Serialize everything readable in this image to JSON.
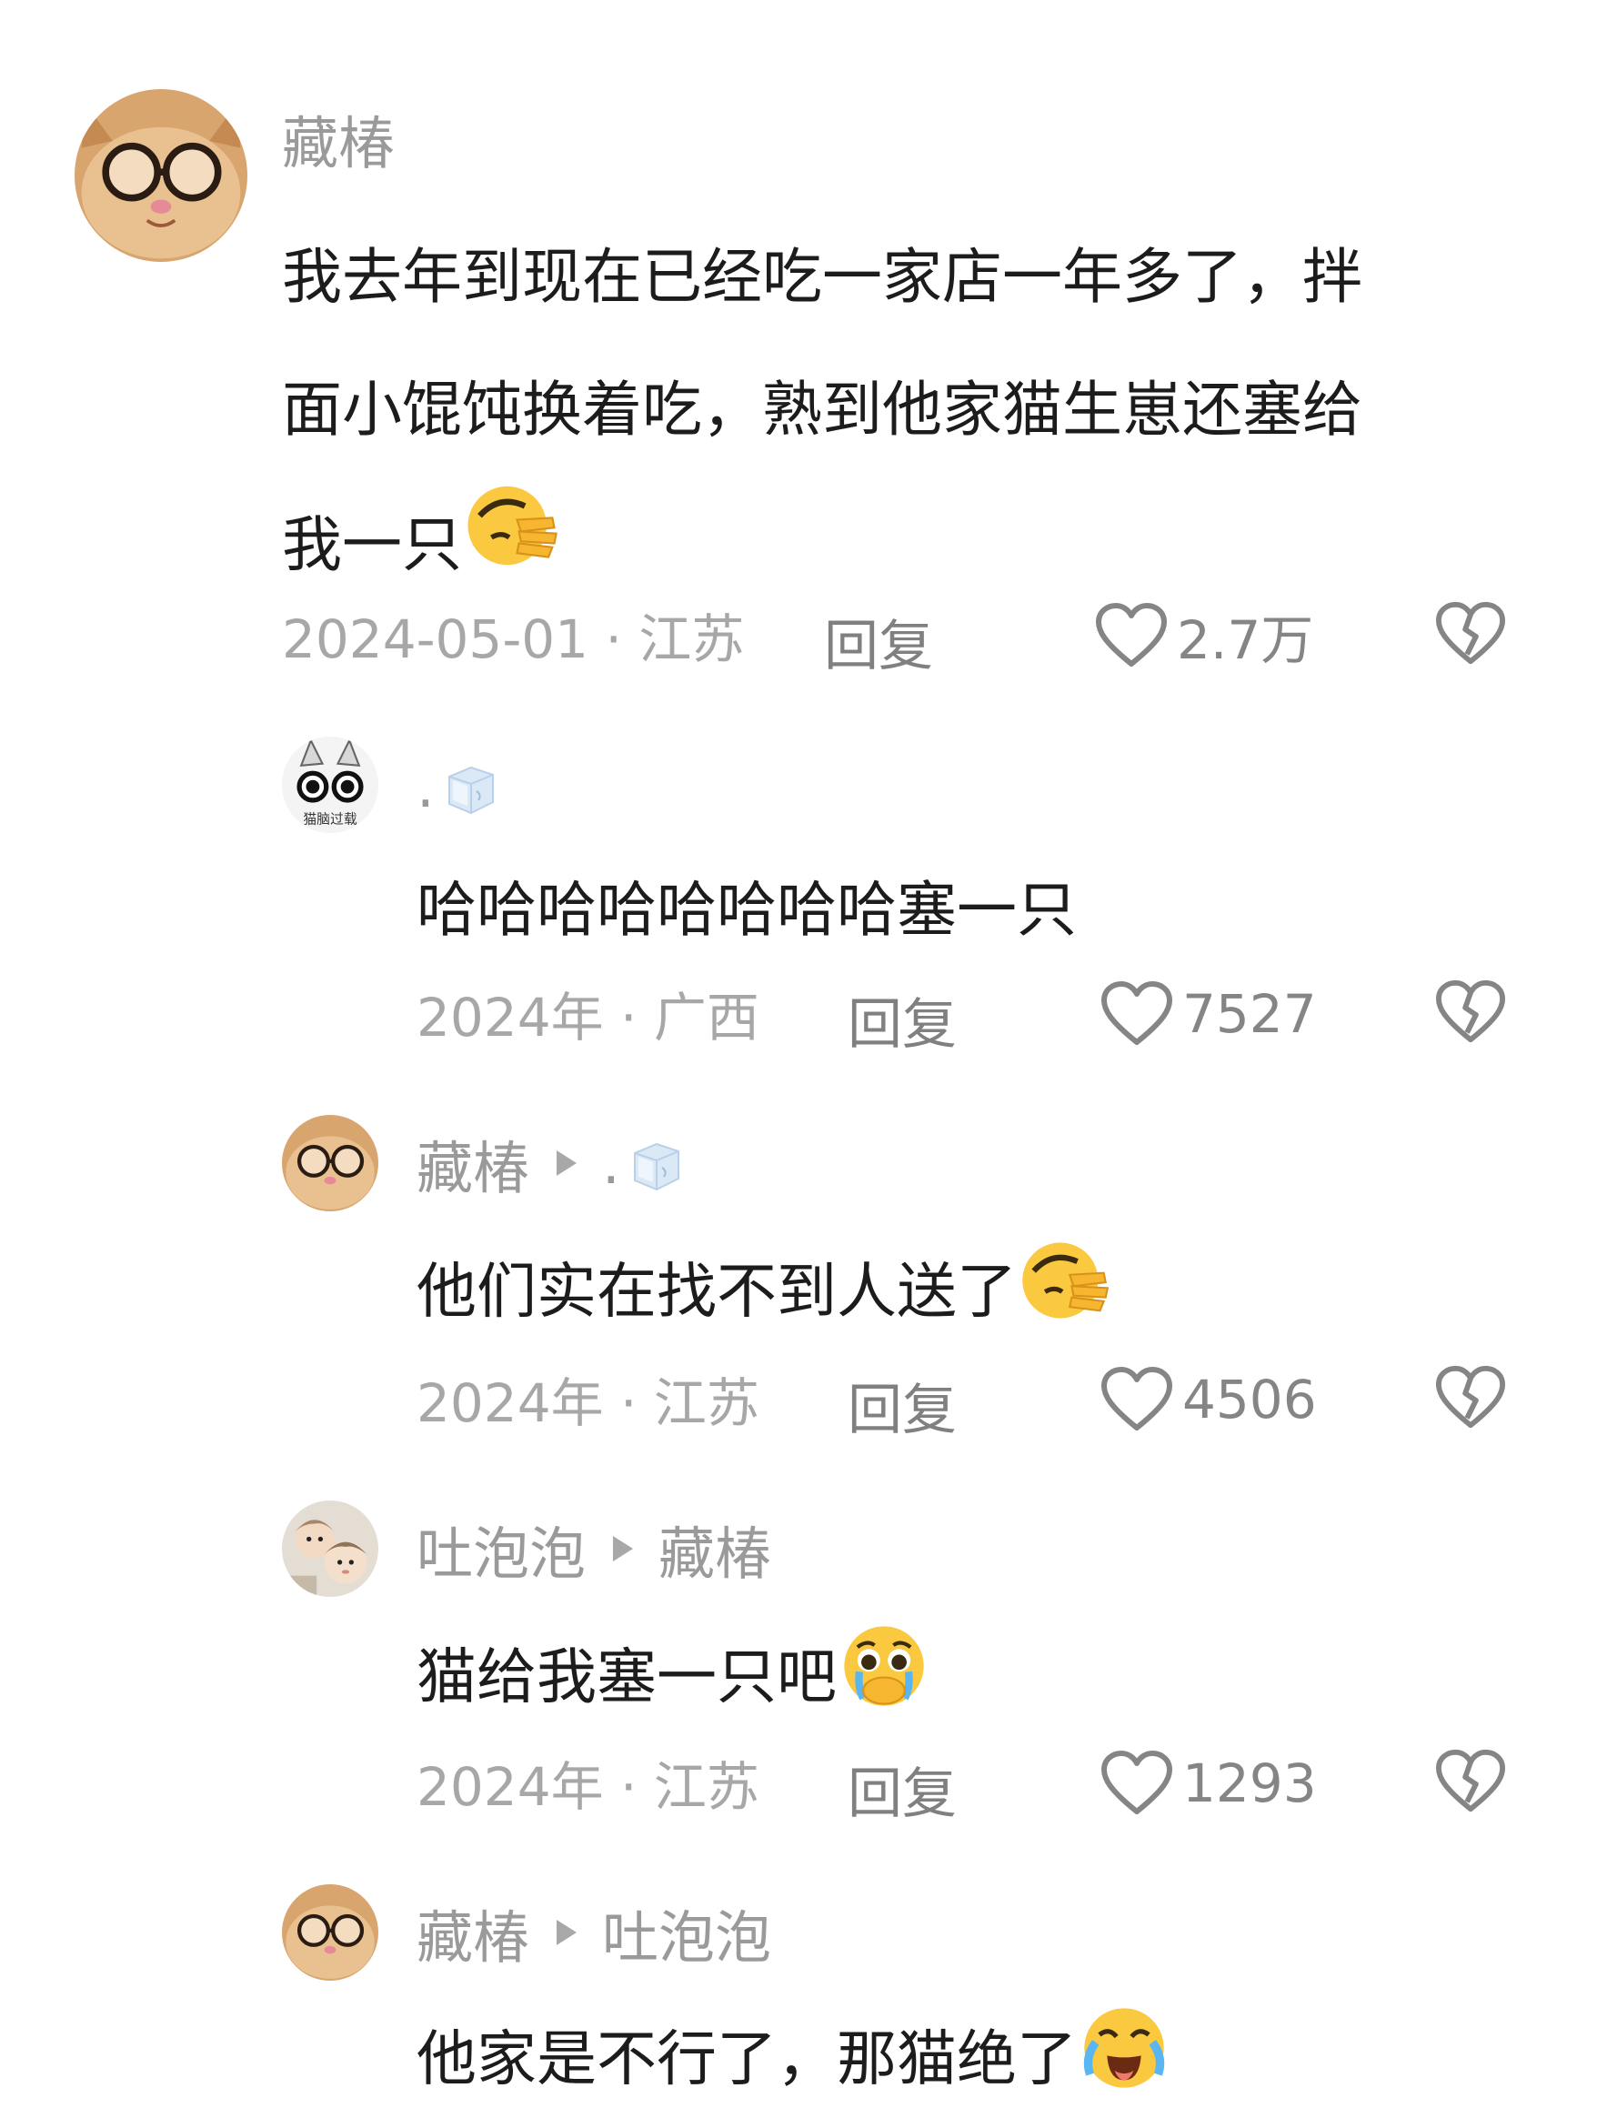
{
  "comments": [
    {
      "name": "藏椿",
      "reply_to": "",
      "text_lines": [
        "我去年到现在已经吃一家店一年多了，拌",
        "面小馄饨换着吃，熟到他家猫生崽还塞给",
        "我一只"
      ],
      "emoji": "facepalm",
      "date_location": "2024-05-01 · 江苏",
      "reply_label": "回复",
      "likes": "2.7万"
    },
    {
      "name": ".",
      "name_icon": "ice-cube-icon",
      "reply_to": "",
      "text_lines": [
        "哈哈哈哈哈哈哈哈塞一只"
      ],
      "emoji": "",
      "date_location": "2024年 · 广西",
      "reply_label": "回复",
      "likes": "7527"
    },
    {
      "name": "藏椿",
      "reply_to": ".",
      "reply_to_icon": "ice-cube-icon",
      "text_lines": [
        "他们实在找不到人送了"
      ],
      "emoji": "facepalm",
      "date_location": "2024年 · 江苏",
      "reply_label": "回复",
      "likes": "4506"
    },
    {
      "name": "吐泡泡",
      "reply_to": "藏椿",
      "text_lines": [
        "猫给我塞一只吧"
      ],
      "emoji": "crying-pleading",
      "date_location": "2024年 · 江苏",
      "reply_label": "回复",
      "likes": "1293"
    },
    {
      "name": "藏椿",
      "reply_to": "吐泡泡",
      "text_lines": [
        "他家是不行了，那猫绝了"
      ],
      "emoji": "crying-laughing",
      "date_location": "",
      "reply_label": "",
      "likes": ""
    }
  ],
  "avatar_sticker_text": "猫脑过载",
  "colors": {
    "name": "#9a9a9a",
    "body": "#1c1c1c",
    "meta": "#a7a7a7",
    "icon": "#858585"
  }
}
